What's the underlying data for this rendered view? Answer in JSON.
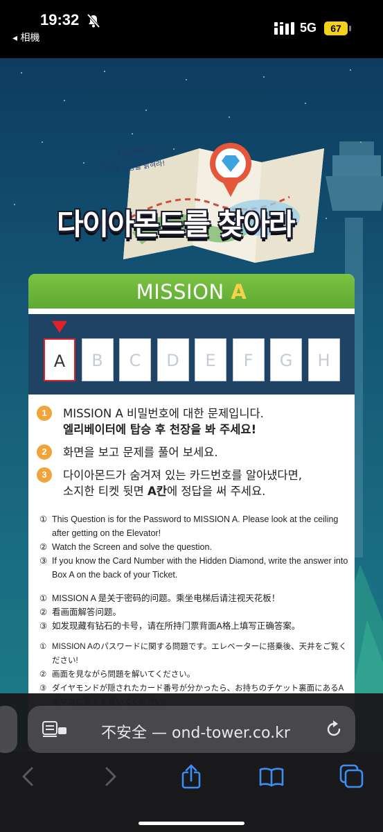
{
  "status_bar": {
    "time": "19:32",
    "back_app": "◂ 相機",
    "network": "5G",
    "battery": "67"
  },
  "logo": {
    "mission_small": "MISSION",
    "mission_line1": "숨겨진 다이아몬드를 찾아",
    "mission_line2": "기억의 심장을 밝혀라!",
    "title": "다이아몬드를 찾아라"
  },
  "card": {
    "header_prefix": "MISSION ",
    "header_letter": "A",
    "slots": [
      "A",
      "B",
      "C",
      "D",
      "E",
      "F",
      "G",
      "H"
    ],
    "active_slot": "A",
    "ko": [
      {
        "num": "1",
        "line1": "MISSION A 비밀번호에 대한 문제입니다.",
        "line2": "엘리베이터에 탑승 후 천장을 봐 주세요!"
      },
      {
        "num": "2",
        "line1": "화면을 보고 문제를 풀어 보세요."
      },
      {
        "num": "3",
        "line1": "다이아몬드가 숨겨져 있는 카드번호를 알아냈다면,",
        "line2_pre": "소지한 티켓 뒷면 ",
        "line2_bold": "A칸",
        "line2_post": "에 정답을 써 주세요."
      }
    ],
    "en": [
      {
        "num": "①",
        "text": "This Question is for the Password to MISSION A. Please look at the ceiling after getting on the Elevator!"
      },
      {
        "num": "②",
        "text": "Watch the Screen and solve the question."
      },
      {
        "num": "③",
        "text": "If you know the Card Number with the Hidden Diamond, write the answer into Box A on the back of your Ticket."
      }
    ],
    "zh": [
      {
        "num": "①",
        "text": "MISSION A 是关于密码的问题。乘坐电梯后请注视天花板！"
      },
      {
        "num": "②",
        "text": "看画面解答问题。"
      },
      {
        "num": "③",
        "text": "如发现藏有钻石的卡号，请在所持门票背面A格上填写正确答案。"
      }
    ],
    "ja": [
      {
        "num": "①",
        "text": "MISSION Aのパスワードに関する問題です。エレベーターに搭乗後、天井をご覧ください!"
      },
      {
        "num": "②",
        "text": "画面を見ながら問題を解いてください。"
      },
      {
        "num": "③",
        "text": "ダイヤモンドが隠されたカード番号が分かったら、お持ちのチケット裏面にあるAのマスに答えを書いてください。"
      }
    ]
  },
  "browser": {
    "url_text": "不安全 — ond-tower.co.kr"
  },
  "icons": [
    "bell-slash-icon",
    "signal-icon",
    "reader-icon",
    "reload-icon",
    "back-icon",
    "forward-icon",
    "share-icon",
    "bookmarks-icon",
    "tabs-icon"
  ]
}
